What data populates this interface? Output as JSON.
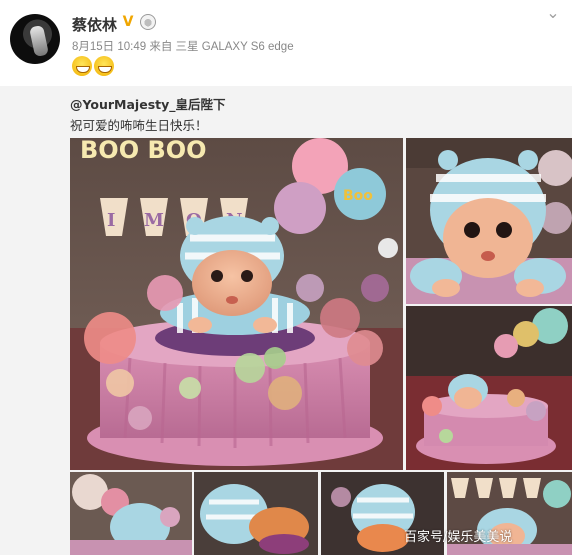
{
  "post": {
    "username": "蔡依林",
    "verified_icon": "v-badge-icon",
    "vip_icon": "vip-medal-icon",
    "meta": "8月15日 10:49 来自 三星 GALAXY S6 edge",
    "emojis": [
      "grin-emoji",
      "grin-emoji"
    ],
    "menu_icon": "chevron-down-icon"
  },
  "repost": {
    "user": "@YourMajesty_皇后陛下",
    "text": "祝可爱的咘咘生日快乐！"
  },
  "photos": [
    {
      "name": "cake-baby-main"
    },
    {
      "name": "cake-baby-closeup"
    },
    {
      "name": "cake-party-room"
    },
    {
      "name": "cake-thumb-1"
    },
    {
      "name": "cake-thumb-2"
    },
    {
      "name": "cake-thumb-3"
    },
    {
      "name": "cake-thumb-4"
    }
  ],
  "decor": {
    "banner": "I M O N",
    "balloon_label": "Boo",
    "sign_text": "BOO BOO"
  },
  "watermark": "百家号/娱乐美美说",
  "colors": {
    "username": "#333333",
    "meta": "#888888",
    "repost_bg": "#f3f3f3",
    "badge": "#f0a600"
  }
}
